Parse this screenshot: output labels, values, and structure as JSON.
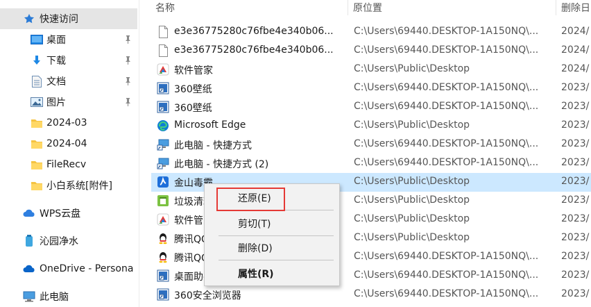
{
  "sidebar": {
    "items": [
      {
        "label": "快速访问",
        "icon": "star-icon",
        "pinned": false
      },
      {
        "label": "桌面",
        "icon": "desktop-icon",
        "pinned": true
      },
      {
        "label": "下载",
        "icon": "download-icon",
        "pinned": true
      },
      {
        "label": "文档",
        "icon": "document-icon",
        "pinned": true
      },
      {
        "label": "图片",
        "icon": "picture-icon",
        "pinned": true
      },
      {
        "label": "2024-03",
        "icon": "folder-icon",
        "pinned": false
      },
      {
        "label": "2024-04",
        "icon": "folder-icon",
        "pinned": false
      },
      {
        "label": "FileRecv",
        "icon": "folder-icon",
        "pinned": false
      },
      {
        "label": "小白系统[附件]",
        "icon": "folder-icon",
        "pinned": false
      },
      {
        "label": "WPS云盘",
        "icon": "cloud-icon",
        "pinned": false
      },
      {
        "label": "沁园净水",
        "icon": "water-icon",
        "pinned": false
      },
      {
        "label": "OneDrive - Persona",
        "icon": "onedrive-icon",
        "pinned": false
      },
      {
        "label": "此电脑",
        "icon": "computer-icon",
        "pinned": false
      }
    ]
  },
  "columns": {
    "name": "名称",
    "location": "原位置",
    "deleted": "删除日"
  },
  "files": [
    {
      "name": "e3e36775280c76fbe4e340b06...",
      "location": "C:\\Users\\69440.DESKTOP-1A150NQ\\...",
      "date": "2024/",
      "icon": "blank-file-icon"
    },
    {
      "name": "e3e36775280c76fbe4e340b06...",
      "location": "C:\\Users\\69440.DESKTOP-1A150NQ\\...",
      "date": "2024/",
      "icon": "blank-file-icon"
    },
    {
      "name": "软件管家",
      "location": "C:\\Users\\Public\\Desktop",
      "date": "2024/",
      "icon": "software-manager-icon"
    },
    {
      "name": "360壁纸",
      "location": "C:\\Users\\69440.DESKTOP-1A150NQ\\...",
      "date": "2023/",
      "icon": "shortcut-icon"
    },
    {
      "name": "360壁纸",
      "location": "C:\\Users\\69440.DESKTOP-1A150NQ\\...",
      "date": "2023/",
      "icon": "shortcut-icon"
    },
    {
      "name": "Microsoft Edge",
      "location": "C:\\Users\\Public\\Desktop",
      "date": "2023/",
      "icon": "edge-icon"
    },
    {
      "name": "此电脑 - 快捷方式",
      "location": "C:\\Users\\69440.DESKTOP-1A150NQ\\...",
      "date": "2023/",
      "icon": "computer-shortcut-icon"
    },
    {
      "name": "此电脑 - 快捷方式 (2)",
      "location": "C:\\Users\\69440.DESKTOP-1A150NQ\\...",
      "date": "2023/",
      "icon": "computer-shortcut-icon"
    },
    {
      "name": "金山毒霸",
      "location": "C:\\Users\\Public\\Desktop",
      "date": "2023/",
      "icon": "kingsoft-icon"
    },
    {
      "name": "垃圾清理",
      "location": "C:\\Users\\Public\\Desktop",
      "date": "2023/",
      "icon": "cleaner-icon"
    },
    {
      "name": "软件管家",
      "location": "C:\\Users\\Public\\Desktop",
      "date": "2023/",
      "icon": "software-manager-icon"
    },
    {
      "name": "腾讯QQ",
      "location": "C:\\Users\\Public\\Desktop",
      "date": "2023/",
      "icon": "qq-icon"
    },
    {
      "name": "腾讯QQ",
      "location": "C:\\Users\\69440.DESKTOP-1A150NQ\\...",
      "date": "2023/",
      "icon": "qq-icon"
    },
    {
      "name": "桌面助手",
      "location": "C:\\Users\\69440.DESKTOP-1A150NQ\\...",
      "date": "2023/",
      "icon": "shortcut-icon"
    },
    {
      "name": "360安全浏览器",
      "location": "C:\\Users\\69440.DESKTOP-1A150NQ\\...",
      "date": "2023/",
      "icon": "shortcut-icon"
    }
  ],
  "context_menu": {
    "restore": "还原(E)",
    "cut": "剪切(T)",
    "delete": "删除(D)",
    "properties": "属性(R)"
  },
  "colors": {
    "selection": "#cce8ff",
    "sidebar_selected": "#e5e5e5",
    "highlight_box": "#e53935"
  }
}
